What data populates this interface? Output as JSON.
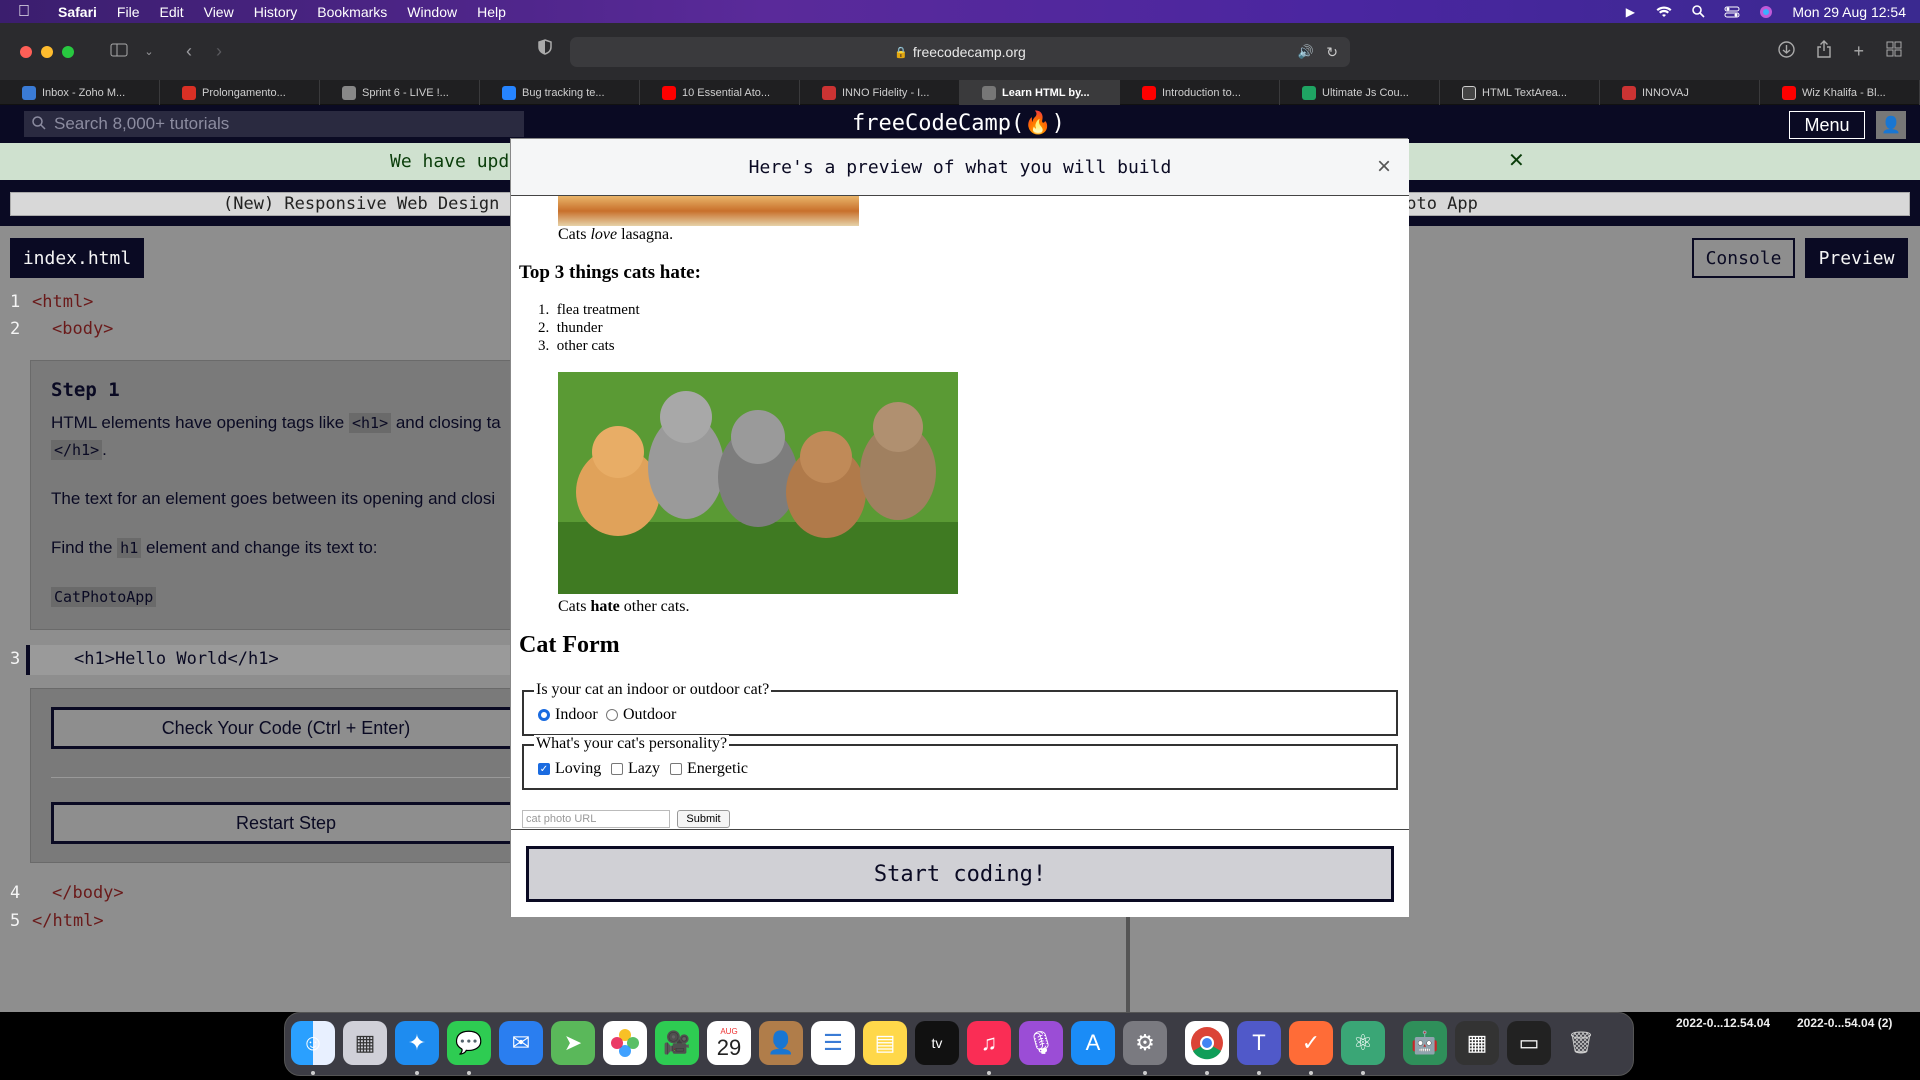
{
  "menubar": {
    "app": "Safari",
    "items": [
      "File",
      "Edit",
      "View",
      "History",
      "Bookmarks",
      "Window",
      "Help"
    ],
    "clock": "Mon 29 Aug  12:54"
  },
  "browser": {
    "url": "freecodecamp.org",
    "tabs": [
      {
        "label": "Inbox - Zoho M...",
        "color": "#3a7bd5"
      },
      {
        "label": "Prolongamento...",
        "color": "#d93025"
      },
      {
        "label": "Sprint 6 - LIVE !...",
        "color": "#888888"
      },
      {
        "label": "Bug tracking te...",
        "color": "#2684ff"
      },
      {
        "label": "10 Essential Ato...",
        "color": "#ff0000"
      },
      {
        "label": "INNO Fidelity - I...",
        "color": "#cc3333"
      },
      {
        "label": "Learn HTML by...",
        "color": "#555555",
        "active": true
      },
      {
        "label": "Introduction to...",
        "color": "#ff0000"
      },
      {
        "label": "Ultimate Js Cou...",
        "color": "#1fa463"
      },
      {
        "label": "HTML TextArea...",
        "color": "#444444"
      },
      {
        "label": "INNOVAJ",
        "color": "#cc3333"
      },
      {
        "label": "Wiz Khalifa - Bl...",
        "color": "#ff0000"
      }
    ]
  },
  "fcc": {
    "search_placeholder": "Search 8,000+ tutorials",
    "logo": "freeCodeCamp(🔥)",
    "menu_label": "Menu",
    "banner": "We have upd",
    "breadcrumb_left": "(New) Responsive Web Design",
    "breadcrumb_right": "hoto App",
    "file_tab": "index.html",
    "console_label": "Console",
    "preview_label": "Preview",
    "code_lines": {
      "l1": "1",
      "l1_code": "<html>",
      "l2": "2",
      "l2_code": "<body>",
      "l3": "3",
      "l3_code": "<h1>Hello World</h1>",
      "l4": "4",
      "l4_code": "</body>",
      "l5": "5",
      "l5_code": "</html>"
    },
    "step": {
      "title": "Step 1",
      "p1_a": "HTML elements have opening tags like",
      "p1_code1": "<h1>",
      "p1_b": "and closing ta",
      "p1_code2": "</h1>",
      "p1_end": ".",
      "p2": "The text for an element goes between its opening and closi",
      "p3_a": "Find the",
      "p3_code": "h1",
      "p3_b": "element and change its text to:",
      "answer": "CatPhotoApp"
    },
    "check_button": "Check Your Code (Ctrl + Enter)",
    "restart_button": "Restart Step"
  },
  "modal": {
    "title": "Here's a preview of what you will build",
    "close": "×",
    "caption1_a": "Cats ",
    "caption1_em": "love",
    "caption1_b": " lasagna.",
    "hate_heading": "Top 3 things cats hate:",
    "hate_list": [
      "flea treatment",
      "thunder",
      "other cats"
    ],
    "caption2_a": "Cats ",
    "caption2_strong": "hate",
    "caption2_b": " other cats.",
    "form_heading": "Cat Form",
    "fieldset1_legend": "Is your cat an indoor or outdoor cat?",
    "indoor": "Indoor",
    "outdoor": "Outdoor",
    "fieldset2_legend": "What's your cat's personality?",
    "loving": "Loving",
    "lazy": "Lazy",
    "energetic": "Energetic",
    "url_placeholder": "cat photo URL",
    "submit": "Submit",
    "start_button": "Start coding!"
  },
  "dock": {
    "calendar_month": "AUG",
    "calendar_day": "29",
    "screenshot_label_1": "2022-0...12.54.04",
    "screenshot_label_2": "2022-0...54.04 (2)"
  }
}
